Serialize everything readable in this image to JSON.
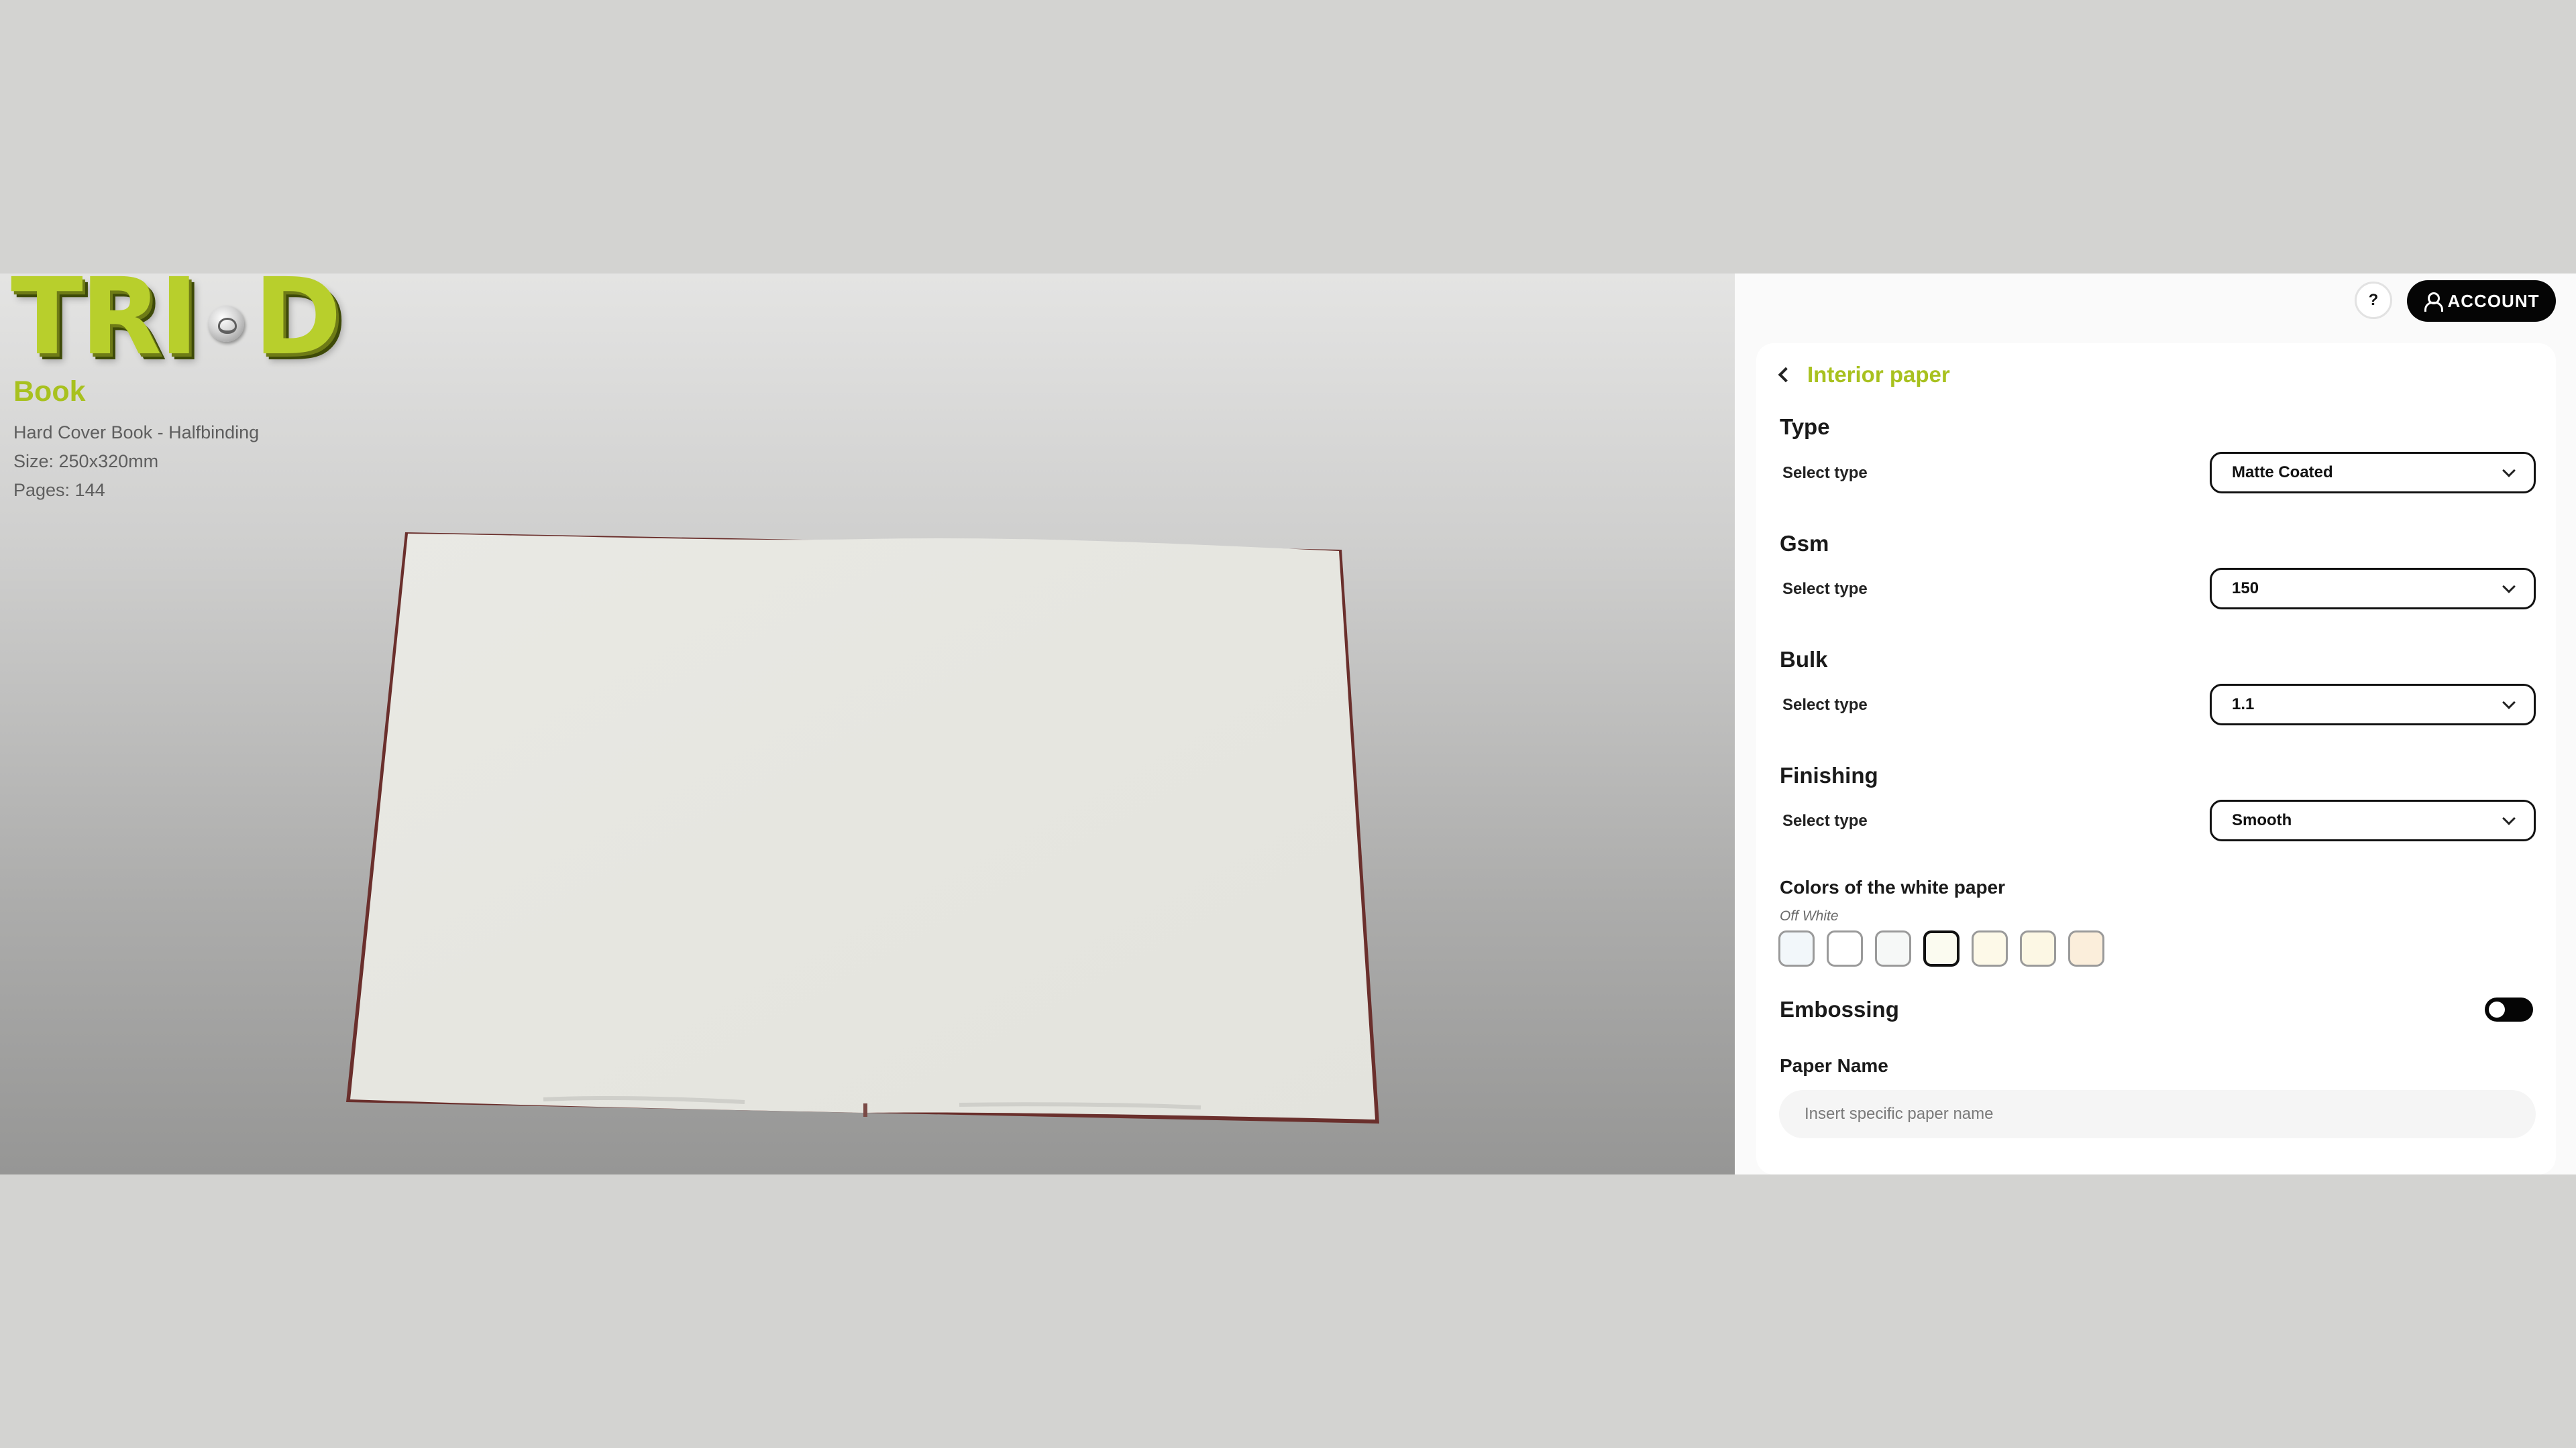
{
  "brand": {
    "logo_left": "TRI",
    "logo_right": "D",
    "accent": "#a8c11f"
  },
  "product": {
    "title": "Book",
    "description": "Hard Cover Book - Halfbinding",
    "size": "Size: 250x320mm",
    "pages": "Pages: 144"
  },
  "header": {
    "help_label": "?",
    "account_label": "ACCOUNT",
    "account_icon": "user-icon"
  },
  "panel": {
    "back_label": "Interior paper",
    "sections": {
      "type": {
        "title": "Type",
        "label": "Select type",
        "value": "Matte Coated"
      },
      "gsm": {
        "title": "Gsm",
        "label": "Select type",
        "value": "150"
      },
      "bulk": {
        "title": "Bulk",
        "label": "Select type",
        "value": "1.1"
      },
      "finishing": {
        "title": "Finishing",
        "label": "Select type",
        "value": "Smooth"
      }
    },
    "colors": {
      "title": "Colors of the white paper",
      "selected_name": "Off White",
      "swatches": [
        "#f2f7fa",
        "#ffffff",
        "#f6f8f7",
        "#fbfbf0",
        "#fdf9e8",
        "#fcf7e4",
        "#fbeedb"
      ],
      "selected_index": 3
    },
    "embossing": {
      "title": "Embossing",
      "enabled": false
    },
    "paper_name": {
      "title": "Paper Name",
      "placeholder": "Insert specific paper name",
      "value": ""
    }
  }
}
